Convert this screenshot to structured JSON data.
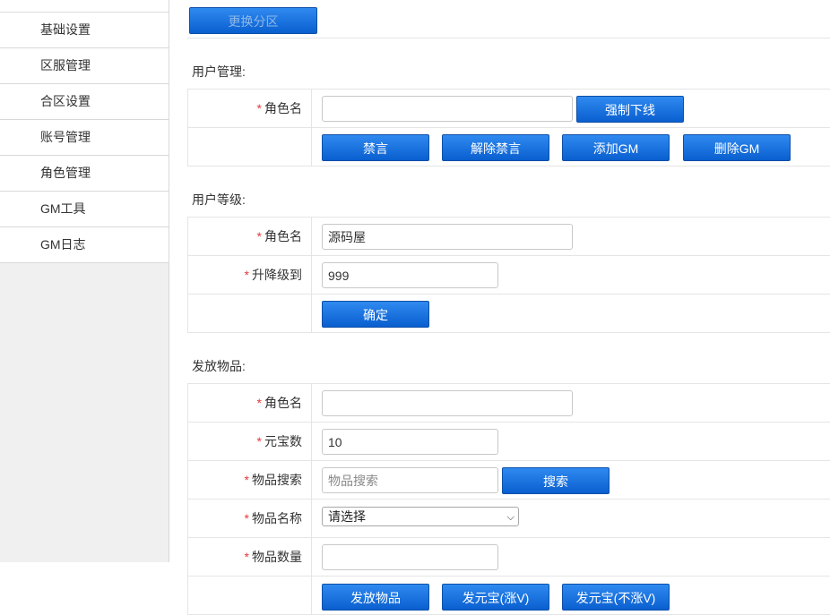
{
  "sidebar": {
    "items": [
      "基础设置",
      "区服管理",
      "合区设置",
      "账号管理",
      "角色管理",
      "GM工具",
      "GM日志"
    ]
  },
  "topbar": {
    "switch_zone": "更换分区"
  },
  "user_mgmt": {
    "title": "用户管理:",
    "role_label": "角色名",
    "role_value": "",
    "kick_button": "强制下线",
    "mute_button": "禁言",
    "unmute_button": "解除禁言",
    "add_gm_button": "添加GM",
    "del_gm_button": "删除GM"
  },
  "user_level": {
    "title": "用户等级:",
    "role_label": "角色名",
    "role_value": "源码屋",
    "level_label": "升降级到",
    "level_value": "999",
    "confirm_button": "确定"
  },
  "items": {
    "title": "发放物品:",
    "role_label": "角色名",
    "role_value": "",
    "yuanbao_label": "元宝数",
    "yuanbao_value": "10",
    "search_label": "物品搜索",
    "search_placeholder": "物品搜索",
    "search_button": "搜索",
    "name_label": "物品名称",
    "name_select": "请选择",
    "qty_label": "物品数量",
    "qty_value": "",
    "send_item_button": "发放物品",
    "send_yb_button": "发元宝(涨V)",
    "send_yb_novip_button": "发元宝(不涨V)"
  },
  "colors": {
    "accent": "#0a5fcf",
    "required_star": "#e4393c"
  }
}
